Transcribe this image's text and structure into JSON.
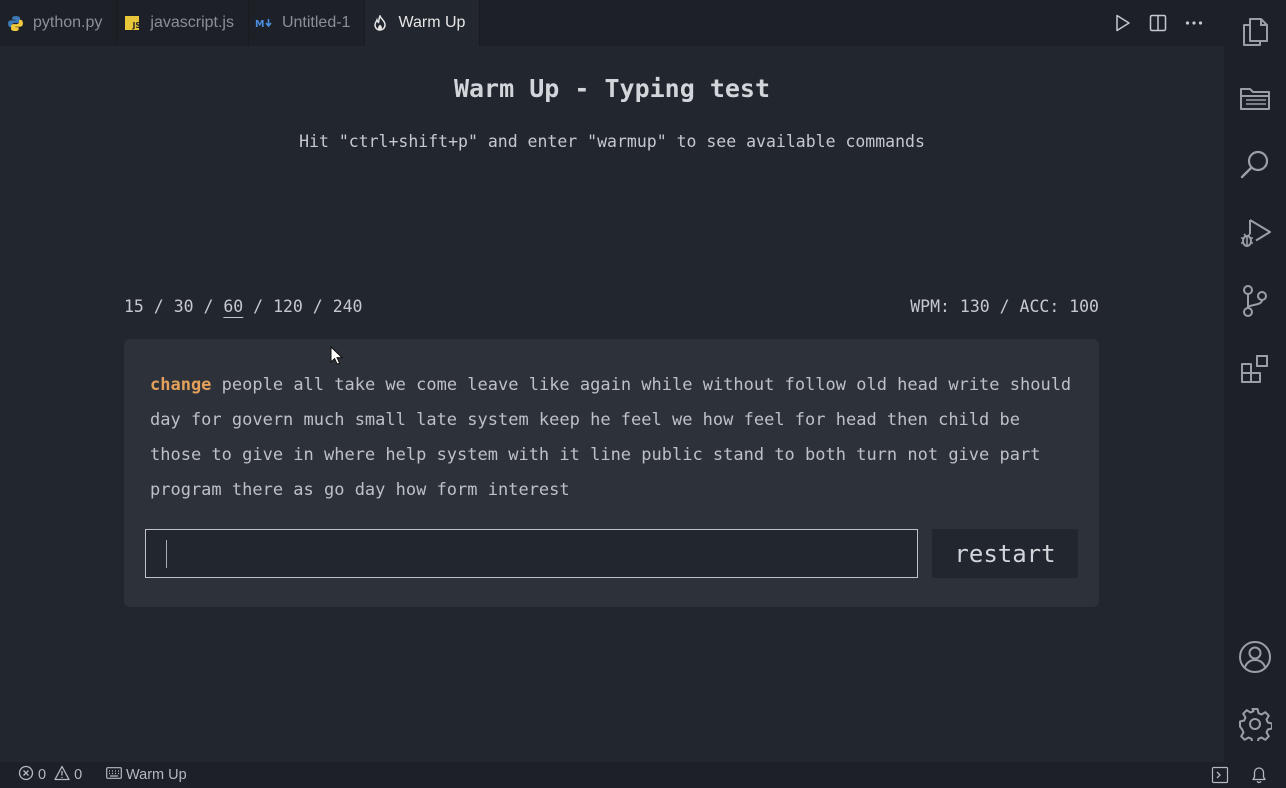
{
  "tabs": [
    {
      "label": "python.py",
      "icon": "python-icon",
      "active": false
    },
    {
      "label": "javascript.js",
      "icon": "javascript-icon",
      "active": false
    },
    {
      "label": "Untitled-1",
      "icon": "markdown-icon",
      "active": false
    },
    {
      "label": "Warm Up",
      "icon": "flame-icon",
      "active": true
    }
  ],
  "tab_actions": [
    "run-icon",
    "split-editor-icon",
    "more-actions-icon"
  ],
  "activity_bar": {
    "top": [
      "explorer-icon",
      "folder-icon",
      "search-icon",
      "run-debug-icon",
      "source-control-icon",
      "extensions-icon"
    ],
    "bottom": [
      "account-icon",
      "settings-gear-icon"
    ]
  },
  "page": {
    "title": "Warm Up - Typing test",
    "subtitle": "Hit \"ctrl+shift+p\" and enter \"warmup\" to see available commands"
  },
  "modes": {
    "items": [
      "15",
      "30",
      "60",
      "120",
      "240"
    ],
    "separator": " / ",
    "selected": "60"
  },
  "stats": {
    "wpm_label": "WPM: ",
    "wpm": "130",
    "separator": " / ",
    "acc_label": "ACC: ",
    "acc": "100"
  },
  "test": {
    "current_word": "change",
    "remaining_text": "people all take we come leave like again while without follow old head write should day for govern much small late system keep he feel we how feel for head then child be those to give in where help system with it line public stand to both turn not give part program there as go day how form interest",
    "input_value": "",
    "restart_label": "restart"
  },
  "statusbar": {
    "errors": "0",
    "warnings": "0",
    "mode_label": "Warm Up"
  },
  "colors": {
    "accent_current_word": "#e3a05a",
    "background": "#22262e",
    "card": "#2d313a"
  }
}
